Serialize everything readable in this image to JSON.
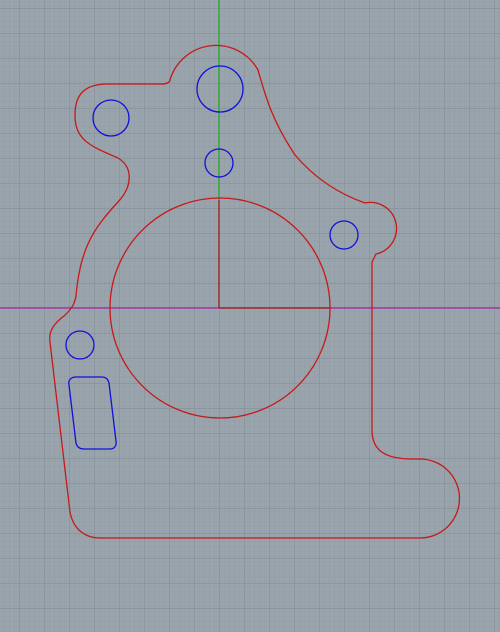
{
  "viewport": {
    "view": "top",
    "grid": true,
    "background_color": "#9aa4ad",
    "grid_minor_color": "#8d97a0",
    "grid_major_color": "#7f8992"
  },
  "axes": {
    "x_axis_color": "#a020a0",
    "y_axis_color": "#22a822",
    "origin_marker_color": "#a01818"
  },
  "part": {
    "outline_color": "#c81818",
    "hole_color": "#1010dd",
    "features": [
      "outer-profile",
      "center-bore",
      "top-hole-large",
      "top-hole-small",
      "top-left-hole",
      "right-hole",
      "lower-left-hole",
      "slot"
    ]
  }
}
